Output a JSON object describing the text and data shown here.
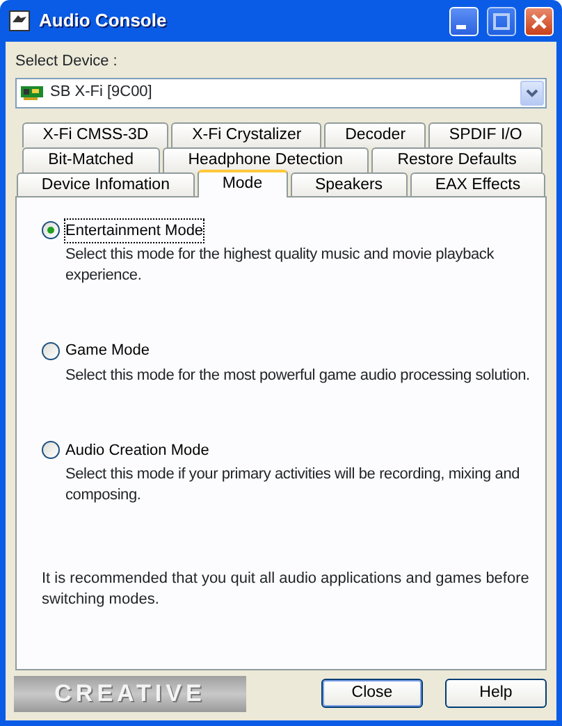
{
  "window": {
    "title": "Audio Console"
  },
  "device": {
    "label": "Select Device :",
    "value": "SB X-Fi [9C00]"
  },
  "tab_rows": [
    [
      {
        "label": "X-Fi CMSS-3D",
        "selected": false
      },
      {
        "label": "X-Fi Crystalizer",
        "selected": false
      },
      {
        "label": "Decoder",
        "selected": false
      },
      {
        "label": "SPDIF I/O",
        "selected": false
      }
    ],
    [
      {
        "label": "Bit-Matched",
        "selected": false
      },
      {
        "label": "Headphone Detection",
        "selected": false
      },
      {
        "label": "Restore Defaults",
        "selected": false
      }
    ],
    [
      {
        "label": "Device Infomation",
        "selected": false
      },
      {
        "label": "Mode",
        "selected": true
      },
      {
        "label": "Speakers",
        "selected": false
      },
      {
        "label": "EAX Effects",
        "selected": false
      }
    ]
  ],
  "modes": [
    {
      "label": "Entertainment Mode",
      "selected": true,
      "description": "Select this mode for the highest quality music and movie playback experience."
    },
    {
      "label": "Game Mode",
      "selected": false,
      "description": "Select this mode for the most powerful game audio processing solution."
    },
    {
      "label": "Audio Creation Mode",
      "selected": false,
      "description": "Select this mode if your primary activities will be recording, mixing and composing."
    }
  ],
  "note": "It is recommended that you quit all audio applications and games before switching modes.",
  "logo": "CREATIVE",
  "buttons": [
    "Close",
    "Help"
  ]
}
